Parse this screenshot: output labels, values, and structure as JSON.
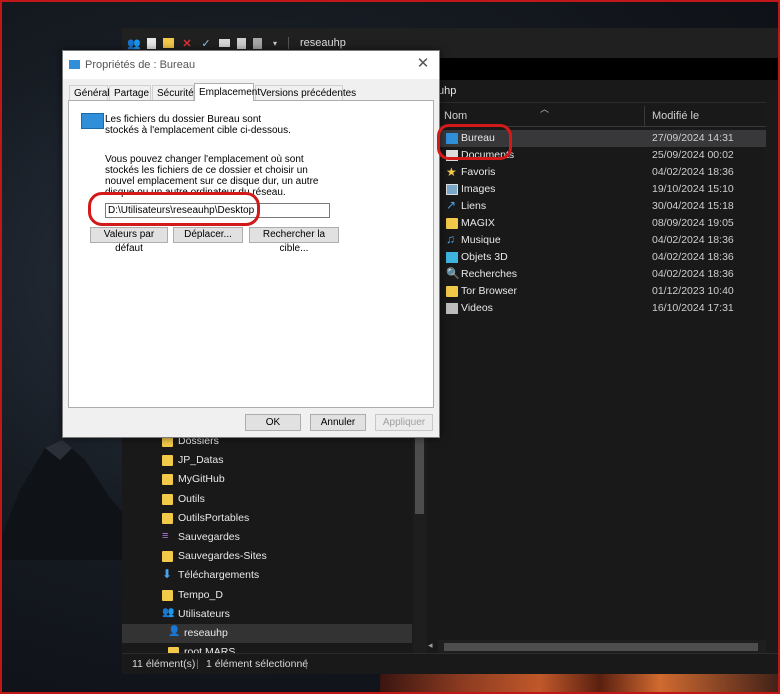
{
  "explorer": {
    "window_title": "reseauhp",
    "address_text": "uhp",
    "columns": {
      "name": "Nom",
      "modified": "Modifié le"
    },
    "files": [
      {
        "name": "Bureau",
        "date": "27/09/2024 14:31",
        "icon": "desktop-icon",
        "selected": true
      },
      {
        "name": "Documents",
        "date": "25/09/2024 00:02",
        "icon": "documents-icon"
      },
      {
        "name": "Favoris",
        "date": "04/02/2024 18:36",
        "icon": "star-icon"
      },
      {
        "name": "Images",
        "date": "19/10/2024 15:10",
        "icon": "images-icon"
      },
      {
        "name": "Liens",
        "date": "30/04/2024 15:18",
        "icon": "link-icon"
      },
      {
        "name": "MAGIX",
        "date": "08/09/2024 19:05",
        "icon": "folder-icon"
      },
      {
        "name": "Musique",
        "date": "04/02/2024 18:36",
        "icon": "music-icon"
      },
      {
        "name": "Objets 3D",
        "date": "04/02/2024 18:36",
        "icon": "cube-icon"
      },
      {
        "name": "Recherches",
        "date": "04/02/2024 18:36",
        "icon": "search-icon"
      },
      {
        "name": "Tor Browser",
        "date": "01/12/2023 10:40",
        "icon": "folder-icon"
      },
      {
        "name": "Videos",
        "date": "16/10/2024 17:31",
        "icon": "video-icon"
      }
    ],
    "nav": [
      {
        "label": "Dossiers",
        "icon": "folder-icon"
      },
      {
        "label": "JP_Datas",
        "icon": "folder-icon"
      },
      {
        "label": "MyGitHub",
        "icon": "folder-icon"
      },
      {
        "label": "Outils",
        "icon": "folder-icon"
      },
      {
        "label": "OutilsPortables",
        "icon": "folder-icon"
      },
      {
        "label": "Sauvegardes",
        "icon": "sync-icon"
      },
      {
        "label": "Sauvegardes-Sites",
        "icon": "folder-icon"
      },
      {
        "label": "Téléchargements",
        "icon": "download-icon"
      },
      {
        "label": "Tempo_D",
        "icon": "folder-icon"
      },
      {
        "label": "Utilisateurs",
        "icon": "users-icon"
      },
      {
        "label": "reseauhp",
        "icon": "user-icon",
        "selected": true
      },
      {
        "label": "root MARS",
        "icon": "folder-icon"
      }
    ],
    "status": {
      "count": "11 élément(s)",
      "selection": "1 élément sélectionné"
    }
  },
  "dialog": {
    "title": "Propriétés de : Bureau",
    "tabs": [
      "Général",
      "Partage",
      "Sécurité",
      "Emplacement",
      "Versions précédentes"
    ],
    "active_tab": "Emplacement",
    "info_text": "Les fichiers du dossier Bureau sont stockés à l'emplacement cible ci-dessous.",
    "description": "Vous pouvez changer l'emplacement où sont stockés les fichiers de ce dossier et choisir un nouvel emplacement sur ce disque dur, un autre disque ou un autre ordinateur du réseau.",
    "path_value": "D:\\Utilisateurs\\reseauhp\\Desktop",
    "buttons": {
      "restore": "Valeurs par défaut",
      "move": "Déplacer...",
      "find_target": "Rechercher la cible...",
      "ok": "OK",
      "cancel": "Annuler",
      "apply": "Appliquer"
    }
  },
  "colors": {
    "highlight_red": "#d21a1a",
    "folder": "#f3c94a",
    "accent_blue": "#2f8fd8"
  }
}
